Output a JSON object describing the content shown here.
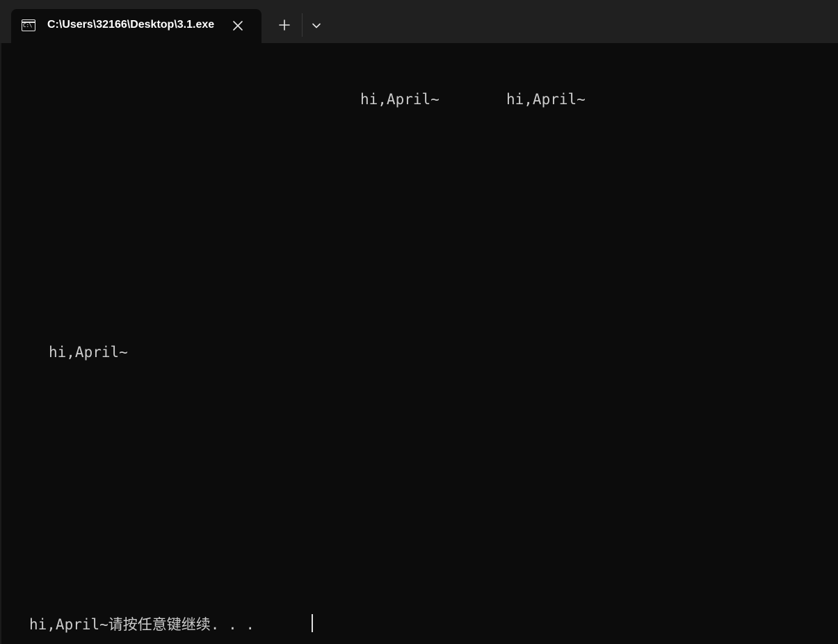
{
  "window": {
    "tab_title": "C:\\Users\\32166\\Desktop\\3.1.exe",
    "tab_icon_glyph": "C:\\",
    "icons": {
      "tab": "console-icon",
      "close": "close-icon",
      "new_tab": "plus-icon",
      "dropdown": "chevron-down-icon"
    }
  },
  "terminal": {
    "lines": [
      "hi,April~",
      "hi,April~",
      "hi,April~",
      "hi,April~请按任意键继续. . ."
    ],
    "colors": {
      "background": "#0c0c0c",
      "foreground": "#cccccc",
      "tabbar": "#202020"
    }
  }
}
